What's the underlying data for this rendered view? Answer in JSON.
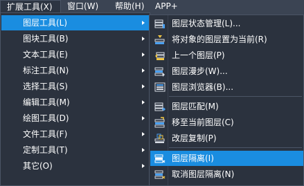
{
  "menubar": {
    "items": [
      {
        "label": "扩展工具(X)"
      },
      {
        "label": "窗口(W)"
      },
      {
        "label": "帮助(H)"
      },
      {
        "label": "APP+"
      }
    ]
  },
  "dropdown": {
    "items": [
      {
        "label": "图层工具(L)"
      },
      {
        "label": "图块工具(B)"
      },
      {
        "label": "文本工具(E)"
      },
      {
        "label": "标注工具(N)"
      },
      {
        "label": "选择工具(S)"
      },
      {
        "label": "编辑工具(M)"
      },
      {
        "label": "绘图工具(D)"
      },
      {
        "label": "文件工具(F)"
      },
      {
        "label": "定制工具(T)"
      },
      {
        "label": "其它(O)"
      }
    ]
  },
  "submenu": {
    "items": [
      {
        "label": "图层状态管理(L)...",
        "icon": "layer-state-icon"
      },
      {
        "label": "将对象的图层置为当前(R)",
        "icon": "make-current-layer-icon"
      },
      {
        "label": "上一个图层(P)",
        "icon": "previous-layer-icon"
      },
      {
        "label": "图层漫步(W)...",
        "icon": "layer-walk-icon"
      },
      {
        "label": "图层浏览器(B)...",
        "icon": "layer-browser-icon"
      },
      {
        "label": "图层匹配(M)",
        "icon": "layer-match-icon"
      },
      {
        "label": "移至当前图层(C)",
        "icon": "move-to-current-layer-icon"
      },
      {
        "label": "改层复制(P)",
        "icon": "copy-to-layer-icon"
      },
      {
        "label": "图层隔离(I)",
        "icon": "layer-isolate-icon"
      },
      {
        "label": "取消图层隔离(N)",
        "icon": "layer-unisolate-icon"
      }
    ]
  },
  "colors": {
    "menubar_bg": "#3b4453",
    "menu_bg": "#2b323e",
    "highlight": "#1a8de0",
    "border": "#4b5566",
    "text": "#ffffff"
  }
}
